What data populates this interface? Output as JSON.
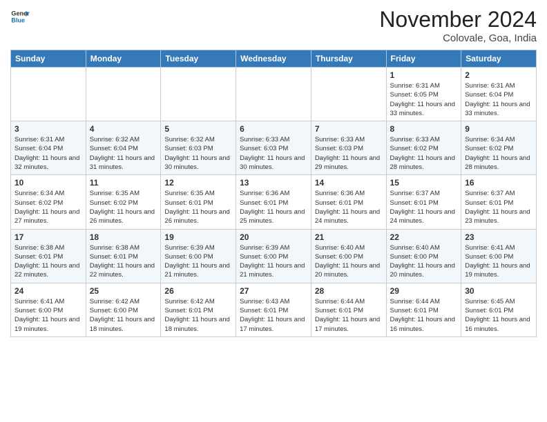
{
  "header": {
    "logo_line1": "General",
    "logo_line2": "Blue",
    "month_title": "November 2024",
    "location": "Colovale, Goa, India"
  },
  "weekdays": [
    "Sunday",
    "Monday",
    "Tuesday",
    "Wednesday",
    "Thursday",
    "Friday",
    "Saturday"
  ],
  "weeks": [
    [
      {
        "day": "",
        "info": ""
      },
      {
        "day": "",
        "info": ""
      },
      {
        "day": "",
        "info": ""
      },
      {
        "day": "",
        "info": ""
      },
      {
        "day": "",
        "info": ""
      },
      {
        "day": "1",
        "info": "Sunrise: 6:31 AM\nSunset: 6:05 PM\nDaylight: 11 hours and 33 minutes."
      },
      {
        "day": "2",
        "info": "Sunrise: 6:31 AM\nSunset: 6:04 PM\nDaylight: 11 hours and 33 minutes."
      }
    ],
    [
      {
        "day": "3",
        "info": "Sunrise: 6:31 AM\nSunset: 6:04 PM\nDaylight: 11 hours and 32 minutes."
      },
      {
        "day": "4",
        "info": "Sunrise: 6:32 AM\nSunset: 6:04 PM\nDaylight: 11 hours and 31 minutes."
      },
      {
        "day": "5",
        "info": "Sunrise: 6:32 AM\nSunset: 6:03 PM\nDaylight: 11 hours and 30 minutes."
      },
      {
        "day": "6",
        "info": "Sunrise: 6:33 AM\nSunset: 6:03 PM\nDaylight: 11 hours and 30 minutes."
      },
      {
        "day": "7",
        "info": "Sunrise: 6:33 AM\nSunset: 6:03 PM\nDaylight: 11 hours and 29 minutes."
      },
      {
        "day": "8",
        "info": "Sunrise: 6:33 AM\nSunset: 6:02 PM\nDaylight: 11 hours and 28 minutes."
      },
      {
        "day": "9",
        "info": "Sunrise: 6:34 AM\nSunset: 6:02 PM\nDaylight: 11 hours and 28 minutes."
      }
    ],
    [
      {
        "day": "10",
        "info": "Sunrise: 6:34 AM\nSunset: 6:02 PM\nDaylight: 11 hours and 27 minutes."
      },
      {
        "day": "11",
        "info": "Sunrise: 6:35 AM\nSunset: 6:02 PM\nDaylight: 11 hours and 26 minutes."
      },
      {
        "day": "12",
        "info": "Sunrise: 6:35 AM\nSunset: 6:01 PM\nDaylight: 11 hours and 26 minutes."
      },
      {
        "day": "13",
        "info": "Sunrise: 6:36 AM\nSunset: 6:01 PM\nDaylight: 11 hours and 25 minutes."
      },
      {
        "day": "14",
        "info": "Sunrise: 6:36 AM\nSunset: 6:01 PM\nDaylight: 11 hours and 24 minutes."
      },
      {
        "day": "15",
        "info": "Sunrise: 6:37 AM\nSunset: 6:01 PM\nDaylight: 11 hours and 24 minutes."
      },
      {
        "day": "16",
        "info": "Sunrise: 6:37 AM\nSunset: 6:01 PM\nDaylight: 11 hours and 23 minutes."
      }
    ],
    [
      {
        "day": "17",
        "info": "Sunrise: 6:38 AM\nSunset: 6:01 PM\nDaylight: 11 hours and 22 minutes."
      },
      {
        "day": "18",
        "info": "Sunrise: 6:38 AM\nSunset: 6:01 PM\nDaylight: 11 hours and 22 minutes."
      },
      {
        "day": "19",
        "info": "Sunrise: 6:39 AM\nSunset: 6:00 PM\nDaylight: 11 hours and 21 minutes."
      },
      {
        "day": "20",
        "info": "Sunrise: 6:39 AM\nSunset: 6:00 PM\nDaylight: 11 hours and 21 minutes."
      },
      {
        "day": "21",
        "info": "Sunrise: 6:40 AM\nSunset: 6:00 PM\nDaylight: 11 hours and 20 minutes."
      },
      {
        "day": "22",
        "info": "Sunrise: 6:40 AM\nSunset: 6:00 PM\nDaylight: 11 hours and 20 minutes."
      },
      {
        "day": "23",
        "info": "Sunrise: 6:41 AM\nSunset: 6:00 PM\nDaylight: 11 hours and 19 minutes."
      }
    ],
    [
      {
        "day": "24",
        "info": "Sunrise: 6:41 AM\nSunset: 6:00 PM\nDaylight: 11 hours and 19 minutes."
      },
      {
        "day": "25",
        "info": "Sunrise: 6:42 AM\nSunset: 6:00 PM\nDaylight: 11 hours and 18 minutes."
      },
      {
        "day": "26",
        "info": "Sunrise: 6:42 AM\nSunset: 6:01 PM\nDaylight: 11 hours and 18 minutes."
      },
      {
        "day": "27",
        "info": "Sunrise: 6:43 AM\nSunset: 6:01 PM\nDaylight: 11 hours and 17 minutes."
      },
      {
        "day": "28",
        "info": "Sunrise: 6:44 AM\nSunset: 6:01 PM\nDaylight: 11 hours and 17 minutes."
      },
      {
        "day": "29",
        "info": "Sunrise: 6:44 AM\nSunset: 6:01 PM\nDaylight: 11 hours and 16 minutes."
      },
      {
        "day": "30",
        "info": "Sunrise: 6:45 AM\nSunset: 6:01 PM\nDaylight: 11 hours and 16 minutes."
      }
    ]
  ]
}
